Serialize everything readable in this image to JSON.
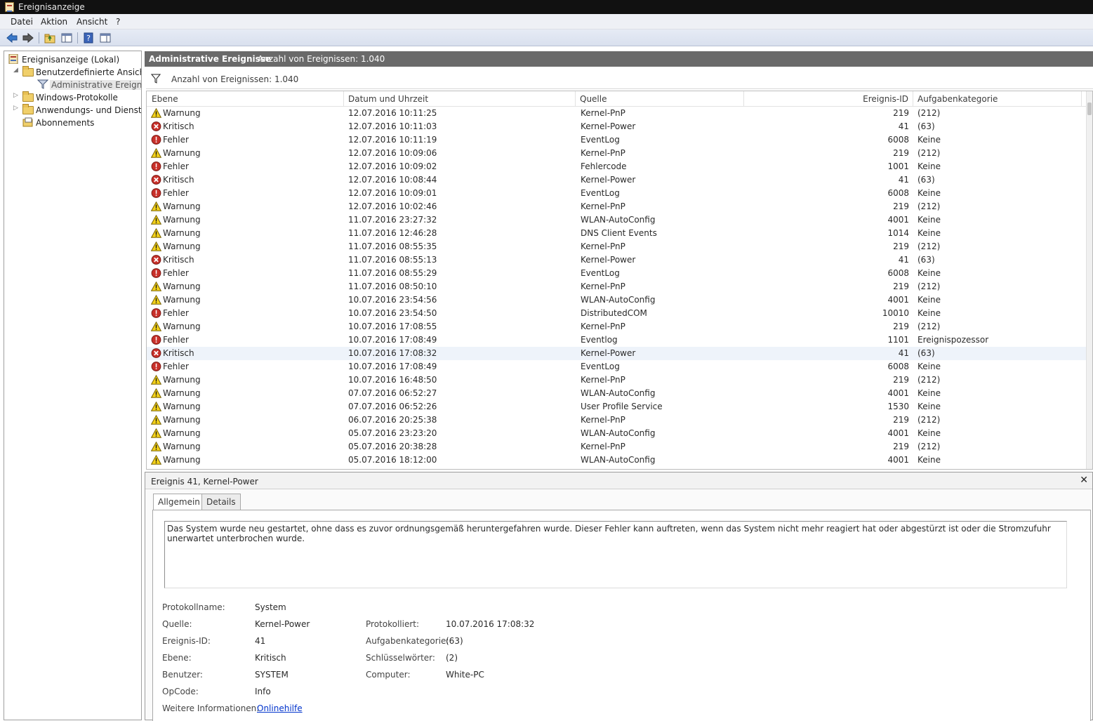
{
  "window": {
    "title": "Ereignisanzeige"
  },
  "menu": [
    "Datei",
    "Aktion",
    "Ansicht",
    "?"
  ],
  "toolbar": [
    "back-icon",
    "forward-icon",
    "up-folder-icon",
    "show-hide-tree-icon",
    "help-icon",
    "properties-icon"
  ],
  "tree": [
    {
      "label": "Ereignisanzeige (Lokal)",
      "icon": "event-viewer-icon"
    },
    {
      "label": "Benutzerdefinierte Ansichten",
      "icon": "folder-open-icon"
    },
    {
      "label": "Administrative Ereignisse",
      "icon": "filter-icon"
    },
    {
      "label": "Windows-Protokolle",
      "icon": "folder-icon"
    },
    {
      "label": "Anwendungs- und Dienstprotokolle",
      "icon": "folder-icon"
    },
    {
      "label": "Abonnements",
      "icon": "subscriptions-icon"
    }
  ],
  "main": {
    "title": "Administrative Ereignisse",
    "count": "Anzahl von Ereignissen: 1.040",
    "filter_text": "Anzahl von Ereignissen: 1.040"
  },
  "columns": [
    "Ebene",
    "Datum und Uhrzeit",
    "Quelle",
    "Ereignis-ID",
    "Aufgabenkategorie"
  ],
  "events": [
    [
      "Warnung",
      "12.07.2016 10:11:25",
      "Kernel-PnP",
      "219",
      "(212)"
    ],
    [
      "Kritisch",
      "12.07.2016 10:11:03",
      "Kernel-Power",
      "41",
      "(63)"
    ],
    [
      "Fehler",
      "12.07.2016 10:11:19",
      "EventLog",
      "6008",
      "Keine"
    ],
    [
      "Warnung",
      "12.07.2016 10:09:06",
      "Kernel-PnP",
      "219",
      "(212)"
    ],
    [
      "Fehler",
      "12.07.2016 10:09:02",
      "Fehlercode",
      "1001",
      "Keine"
    ],
    [
      "Kritisch",
      "12.07.2016 10:08:44",
      "Kernel-Power",
      "41",
      "(63)"
    ],
    [
      "Fehler",
      "12.07.2016 10:09:01",
      "EventLog",
      "6008",
      "Keine"
    ],
    [
      "Warnung",
      "12.07.2016 10:02:46",
      "Kernel-PnP",
      "219",
      "(212)"
    ],
    [
      "Warnung",
      "11.07.2016 23:27:32",
      "WLAN-AutoConfig",
      "4001",
      "Keine"
    ],
    [
      "Warnung",
      "11.07.2016 12:46:28",
      "DNS Client Events",
      "1014",
      "Keine"
    ],
    [
      "Warnung",
      "11.07.2016 08:55:35",
      "Kernel-PnP",
      "219",
      "(212)"
    ],
    [
      "Kritisch",
      "11.07.2016 08:55:13",
      "Kernel-Power",
      "41",
      "(63)"
    ],
    [
      "Fehler",
      "11.07.2016 08:55:29",
      "EventLog",
      "6008",
      "Keine"
    ],
    [
      "Warnung",
      "11.07.2016 08:50:10",
      "Kernel-PnP",
      "219",
      "(212)"
    ],
    [
      "Warnung",
      "10.07.2016 23:54:56",
      "WLAN-AutoConfig",
      "4001",
      "Keine"
    ],
    [
      "Fehler",
      "10.07.2016 23:54:50",
      "DistributedCOM",
      "10010",
      "Keine"
    ],
    [
      "Warnung",
      "10.07.2016 17:08:55",
      "Kernel-PnP",
      "219",
      "(212)"
    ],
    [
      "Fehler",
      "10.07.2016 17:08:49",
      "Eventlog",
      "1101",
      "Ereignispozessor"
    ],
    [
      "Kritisch",
      "10.07.2016 17:08:32",
      "Kernel-Power",
      "41",
      "(63)"
    ],
    [
      "Fehler",
      "10.07.2016 17:08:49",
      "EventLog",
      "6008",
      "Keine"
    ],
    [
      "Warnung",
      "10.07.2016 16:48:50",
      "Kernel-PnP",
      "219",
      "(212)"
    ],
    [
      "Warnung",
      "07.07.2016 06:52:27",
      "WLAN-AutoConfig",
      "4001",
      "Keine"
    ],
    [
      "Warnung",
      "07.07.2016 06:52:26",
      "User Profile Service",
      "1530",
      "Keine"
    ],
    [
      "Warnung",
      "06.07.2016 20:25:38",
      "Kernel-PnP",
      "219",
      "(212)"
    ],
    [
      "Warnung",
      "05.07.2016 23:23:20",
      "WLAN-AutoConfig",
      "4001",
      "Keine"
    ],
    [
      "Warnung",
      "05.07.2016 20:38:28",
      "Kernel-PnP",
      "219",
      "(212)"
    ],
    [
      "Warnung",
      "05.07.2016 18:12:00",
      "WLAN-AutoConfig",
      "4001",
      "Keine"
    ]
  ],
  "highlighted_row": 18,
  "level_icons": {
    "Warnung": "warning-icon",
    "Kritisch": "critical-icon",
    "Fehler": "error-icon"
  },
  "colors": {
    "warning": "#f4d21a",
    "critical": "#c8302a",
    "error": "#c8302a",
    "header": "#6a6a6a",
    "link": "#0033cc"
  },
  "detail": {
    "title": "Ereignis 41, Kernel-Power",
    "close": "✕",
    "tabs": [
      "Allgemein",
      "Details"
    ],
    "description": "Das System wurde neu gestartet, ohne dass es zuvor ordnungsgemäß heruntergefahren wurde. Dieser Fehler kann auftreten, wenn das System nicht mehr reagiert hat oder abgestürzt ist oder die Stromzufuhr unerwartet unterbrochen wurde.",
    "fields": {
      "protokollname_label": "Protokollname:",
      "protokollname": "System",
      "quelle_label": "Quelle:",
      "quelle": "Kernel-Power",
      "protokolliert_label": "Protokolliert:",
      "protokolliert": "10.07.2016 17:08:32",
      "ereignis_id_label": "Ereignis-ID:",
      "ereignis_id": "41",
      "aufgabenkategorie_label": "Aufgabenkategorie:",
      "aufgabenkategorie": "(63)",
      "ebene_label": "Ebene:",
      "ebene": "Kritisch",
      "schluesselwoerter_label": "Schlüsselwörter:",
      "schluesselwoerter": "(2)",
      "benutzer_label": "Benutzer:",
      "benutzer": "SYSTEM",
      "computer_label": "Computer:",
      "computer": "White-PC",
      "opcode_label": "OpCode:",
      "opcode": "Info",
      "weitere_label": "Weitere Informationen:",
      "weitere_link": "Onlinehilfe"
    }
  }
}
